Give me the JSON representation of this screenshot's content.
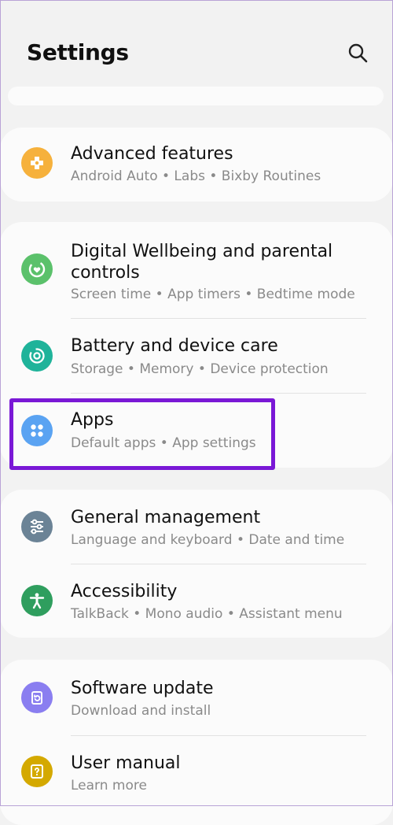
{
  "header": {
    "title": "Settings",
    "search_icon": "search-icon"
  },
  "colors": {
    "highlight_border": "#7a18d6",
    "advanced_icon": "#f6b13c",
    "wellbeing_icon": "#5bc16b",
    "battery_icon": "#1fb39a",
    "apps_icon": "#5aa3f2",
    "general_icon": "#6b8396",
    "accessibility_icon": "#2f9e5e",
    "software_icon": "#8a7ef0",
    "manual_icon": "#d4a900"
  },
  "items": {
    "advanced": {
      "label": "Advanced features",
      "subtitle": "Android Auto  •  Labs  •  Bixby Routines",
      "icon": "plus-puzzle-icon"
    },
    "wellbeing": {
      "label_line1": "Digital Wellbeing and parental",
      "label_line2": "controls",
      "subtitle": "Screen time  •  App timers  •  Bedtime mode",
      "icon": "heart-circle-icon"
    },
    "battery": {
      "label": "Battery and device care",
      "subtitle": "Storage  •  Memory  •  Device protection",
      "icon": "device-care-icon"
    },
    "apps": {
      "label": "Apps",
      "subtitle": "Default apps  •  App settings",
      "icon": "apps-grid-icon"
    },
    "general": {
      "label": "General management",
      "subtitle": "Language and keyboard  •  Date and time",
      "icon": "sliders-icon"
    },
    "accessibility": {
      "label": "Accessibility",
      "subtitle": "TalkBack  •  Mono audio  •  Assistant menu",
      "icon": "accessibility-person-icon"
    },
    "software": {
      "label": "Software update",
      "subtitle": "Download and install",
      "icon": "update-icon"
    },
    "manual": {
      "label": "User manual",
      "subtitle": "Learn more",
      "icon": "manual-question-icon"
    }
  }
}
